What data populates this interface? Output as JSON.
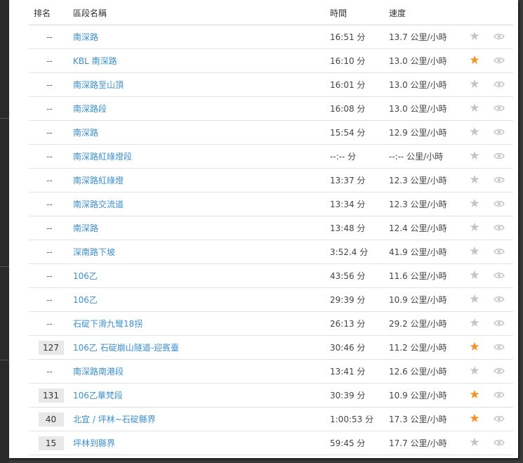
{
  "header": {
    "rank": "排名",
    "name": "區段名稱",
    "time": "時間",
    "speed": "速度"
  },
  "rows": [
    {
      "rank": "--",
      "name": "南深路",
      "time": "16:51 分",
      "speed": "13.7 公里/小時",
      "starred": false
    },
    {
      "rank": "--",
      "name": "KBL 南深路",
      "time": "16:10 分",
      "speed": "13.0 公里/小時",
      "starred": true
    },
    {
      "rank": "--",
      "name": "南深路至山頂",
      "time": "16:01 分",
      "speed": "13.0 公里/小時",
      "starred": false
    },
    {
      "rank": "--",
      "name": "南深路段",
      "time": "16:08 分",
      "speed": "13.0 公里/小時",
      "starred": false
    },
    {
      "rank": "--",
      "name": "南深路",
      "time": "15:54 分",
      "speed": "12.9 公里/小時",
      "starred": false
    },
    {
      "rank": "--",
      "name": "南深路紅綠燈段",
      "time": "--:-- 分",
      "speed": "--:-- 公里/小時",
      "starred": false
    },
    {
      "rank": "--",
      "name": "南深路紅綠燈",
      "time": "13:37 分",
      "speed": "12.3 公里/小時",
      "starred": false
    },
    {
      "rank": "--",
      "name": "南深路交流道",
      "time": "13:34 分",
      "speed": "12.3 公里/小時",
      "starred": false
    },
    {
      "rank": "--",
      "name": "南深路",
      "time": "13:48 分",
      "speed": "12.4 公里/小時",
      "starred": false
    },
    {
      "rank": "--",
      "name": "深南路下坡",
      "time": "3:52.4 分",
      "speed": "41.9 公里/小時",
      "starred": false
    },
    {
      "rank": "--",
      "name": "106乙",
      "time": "43:56 分",
      "speed": "11.6 公里/小時",
      "starred": false
    },
    {
      "rank": "--",
      "name": "106乙",
      "time": "29:39 分",
      "speed": "10.9 公里/小時",
      "starred": false
    },
    {
      "rank": "--",
      "name": "石碇下滑九彎18拐",
      "time": "26:13 分",
      "speed": "29.2 公里/小時",
      "starred": false
    },
    {
      "rank": "127",
      "name": "106乙 石碇崩山隧道-迎賓臺",
      "time": "30:46 分",
      "speed": "11.2 公里/小時",
      "starred": true
    },
    {
      "rank": "--",
      "name": "南深路南港段",
      "time": "13:41 分",
      "speed": "12.6 公里/小時",
      "starred": false
    },
    {
      "rank": "131",
      "name": "106乙華梵段",
      "time": "30:39 分",
      "speed": "10.9 公里/小時",
      "starred": true
    },
    {
      "rank": "40",
      "name": "北宜 / 坪林~石碇縣界",
      "time": "1:00:53 分",
      "speed": "17.3 公里/小時",
      "starred": true
    },
    {
      "rank": "15",
      "name": "坪林到縣界",
      "time": "59:45 分",
      "speed": "17.7 公里/小時",
      "starred": false
    }
  ],
  "icons": {
    "star": "star-icon",
    "eye": "eye-icon"
  },
  "colors": {
    "link": "#3a8fd0",
    "star_on": "#f5921e",
    "star_off": "#c4c4c4"
  }
}
